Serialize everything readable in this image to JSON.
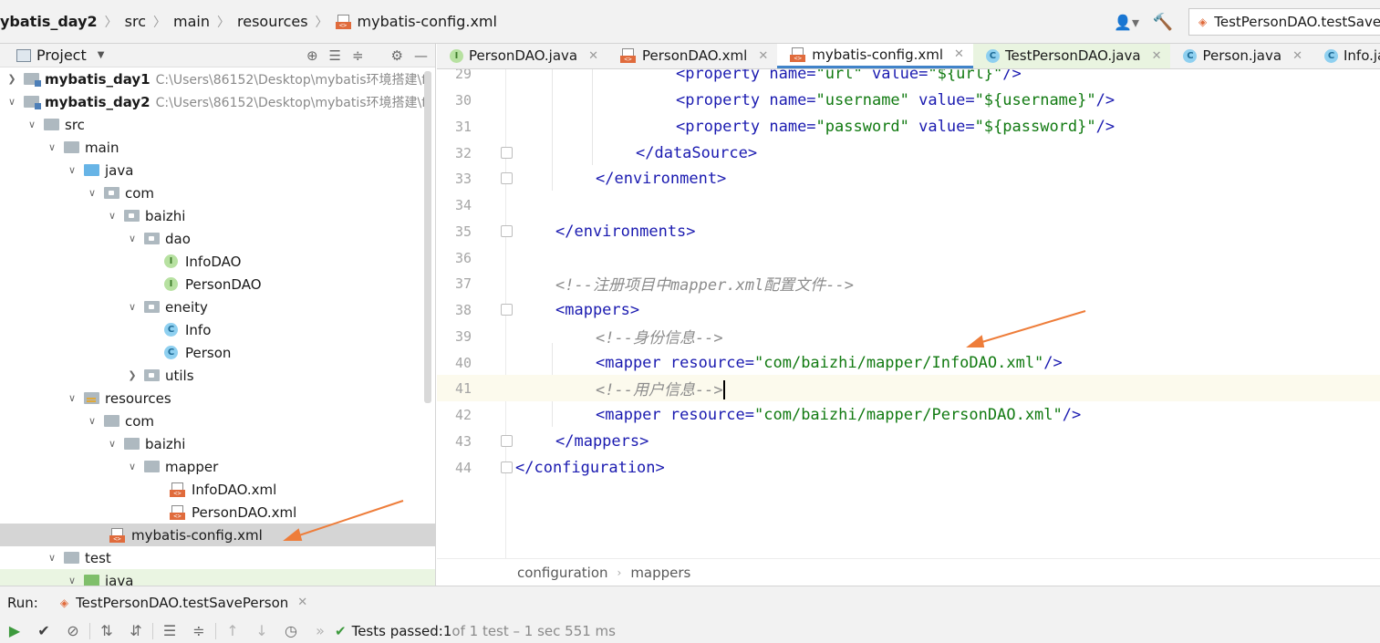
{
  "topbar": {
    "crumbs": [
      "ybatis_day2",
      "src",
      "main",
      "resources",
      "mybatis-config.xml"
    ],
    "run_config": "TestPersonDAO.testSave"
  },
  "project_panel": {
    "title": "Project",
    "tree": [
      {
        "label": "mybatis_day1",
        "hint": "C:\\Users\\86152\\Desktop\\mybatis环境搭建\\f"
      },
      {
        "label": "mybatis_day2",
        "hint": "C:\\Users\\86152\\Desktop\\mybatis环境搭建\\f"
      },
      {
        "label": "src"
      },
      {
        "label": "main"
      },
      {
        "label": "java"
      },
      {
        "label": "com"
      },
      {
        "label": "baizhi"
      },
      {
        "label": "dao"
      },
      {
        "label": "InfoDAO"
      },
      {
        "label": "PersonDAO"
      },
      {
        "label": "eneity"
      },
      {
        "label": "Info"
      },
      {
        "label": "Person"
      },
      {
        "label": "utils"
      },
      {
        "label": "resources"
      },
      {
        "label": "com"
      },
      {
        "label": "baizhi"
      },
      {
        "label": "mapper"
      },
      {
        "label": "InfoDAO.xml"
      },
      {
        "label": "PersonDAO.xml"
      },
      {
        "label": "mybatis-config.xml"
      },
      {
        "label": "test"
      },
      {
        "label": "java"
      }
    ]
  },
  "tabs": [
    {
      "label": "PersonDAO.java",
      "icon": "interface-icon"
    },
    {
      "label": "PersonDAO.xml",
      "icon": "xml-icon"
    },
    {
      "label": "mybatis-config.xml",
      "icon": "xml-icon"
    },
    {
      "label": "TestPersonDAO.java",
      "icon": "test-class-icon"
    },
    {
      "label": "Person.java",
      "icon": "class-icon"
    },
    {
      "label": "Info.java",
      "icon": "class-icon"
    }
  ],
  "editor": {
    "line_numbers": [
      "29",
      "30",
      "31",
      "32",
      "33",
      "34",
      "35",
      "36",
      "37",
      "38",
      "39",
      "40",
      "41",
      "42",
      "43",
      "44"
    ],
    "lines": {
      "l29": {
        "tag": "<property ",
        "a1": "name=",
        "v1": "\"url\"",
        "a2": " value=",
        "v2": "\"${url}\"",
        "end": "/>"
      },
      "l30": {
        "tag": "<property ",
        "a1": "name=",
        "v1": "\"username\"",
        "a2": " value=",
        "v2": "\"${username}\"",
        "end": "/>"
      },
      "l31": {
        "tag": "<property ",
        "a1": "name=",
        "v1": "\"password\"",
        "a2": " value=",
        "v2": "\"${password}\"",
        "end": "/>"
      },
      "l32": "</dataSource>",
      "l33": "</environment>",
      "l35": "</environments>",
      "l37": "<!--注册项目中mapper.xml配置文件-->",
      "l38": "<mappers>",
      "l39": "<!--身份信息-->",
      "l40": {
        "tag": "<mapper ",
        "a1": "resource=",
        "v1": "\"com/baizhi/mapper/InfoDAO.xml\"",
        "end": "/>"
      },
      "l41": "<!--用户信息-->",
      "l42": {
        "tag": "<mapper ",
        "a1": "resource=",
        "v1": "\"com/baizhi/mapper/PersonDAO.xml\"",
        "end": "/>"
      },
      "l43": "</mappers>",
      "l44": "</configuration>"
    }
  },
  "editor_breadcrumbs": [
    "configuration",
    "mappers"
  ],
  "run": {
    "label": "Run:",
    "tab": "TestPersonDAO.testSavePerson",
    "status_prefix": "Tests passed: ",
    "status_count": "1",
    "status_rest": " of 1 test – 1 sec 551 ms"
  },
  "colors": {
    "tag": "#1a1ab0",
    "string": "#117a11",
    "comment": "#8c8c8c",
    "accent": "#4083c9",
    "annotation_arrow": "#ee7d3a"
  }
}
